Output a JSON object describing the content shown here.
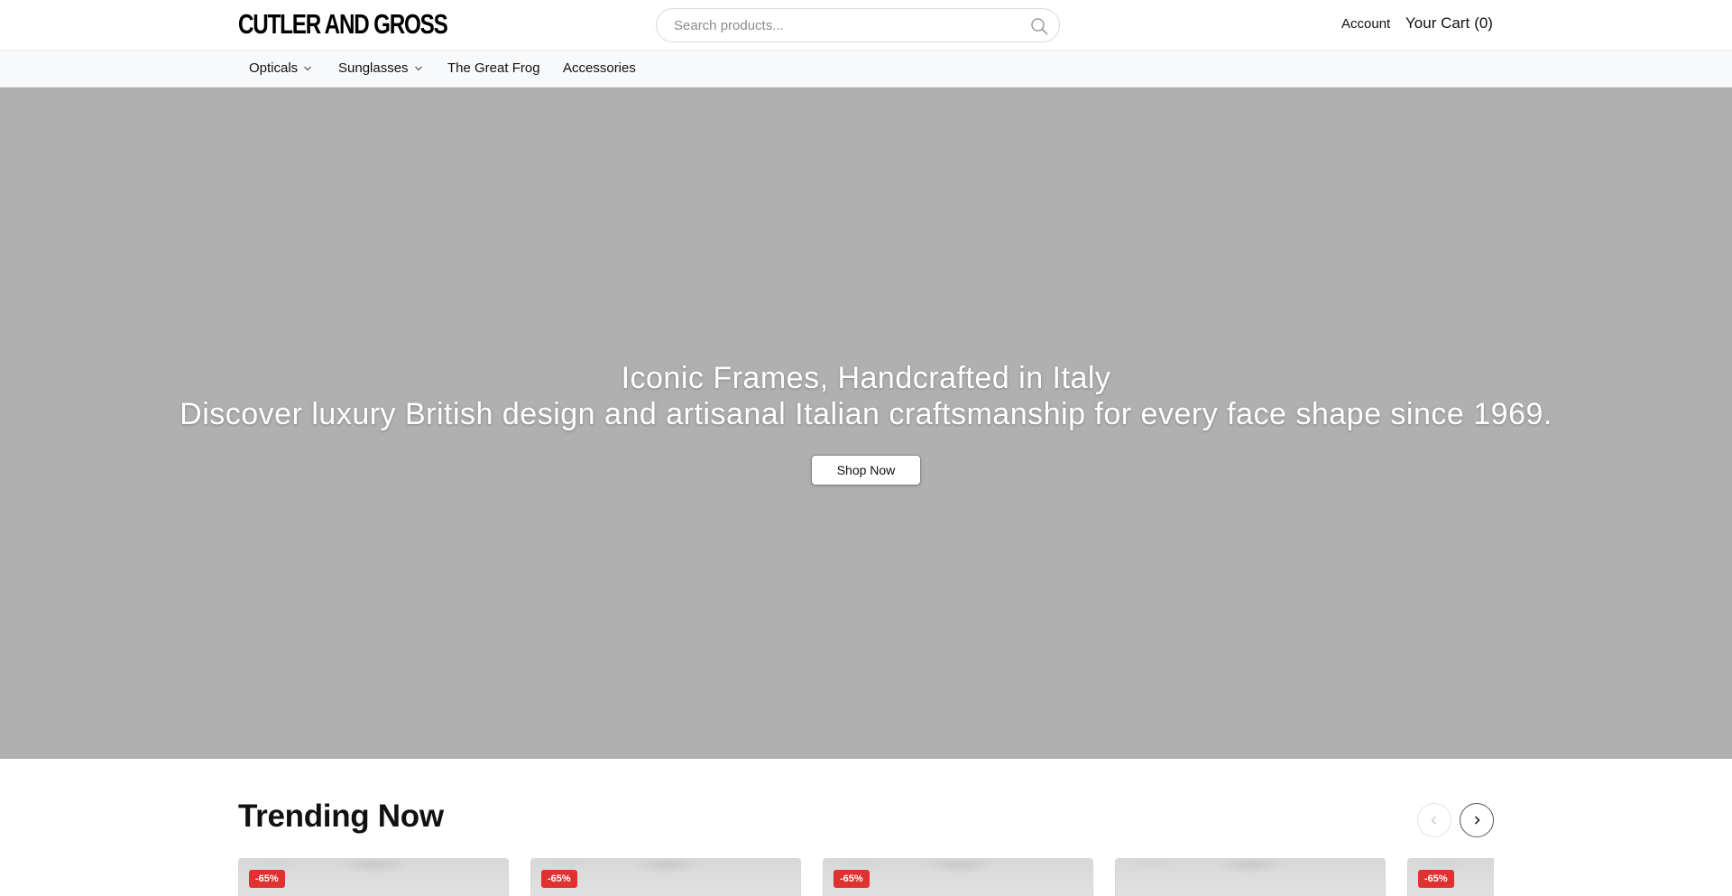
{
  "header": {
    "logo_text": "CUTLER AND GROSS",
    "search": {
      "placeholder": "Search products...",
      "value": ""
    },
    "account_label": "Account",
    "cart_label": "Your Cart",
    "cart_count": "(0)"
  },
  "nav": {
    "items": [
      {
        "label": "Opticals",
        "has_dropdown": true
      },
      {
        "label": "Sunglasses",
        "has_dropdown": true
      },
      {
        "label": "The Great Frog",
        "has_dropdown": false
      },
      {
        "label": "Accessories",
        "has_dropdown": false
      }
    ]
  },
  "hero": {
    "title": "Iconic Frames, Handcrafted in Italy",
    "subtitle": "Discover luxury British design and artisanal Italian craftsmanship for every face shape since 1969.",
    "cta_label": "Shop Now",
    "background_color": "#b0b0b0"
  },
  "trending": {
    "title": "Trending Now",
    "products": [
      {
        "badge": "-65%"
      },
      {
        "badge": "-65%"
      },
      {
        "badge": "-65%"
      },
      {
        "badge": ""
      },
      {
        "badge": "-65%"
      }
    ]
  },
  "colors": {
    "badge": "#e03131",
    "nav_bg": "#f8f9fb"
  },
  "icons": [
    "search-icon",
    "chevron-down-icon",
    "chevron-left-icon",
    "chevron-right-icon"
  ]
}
